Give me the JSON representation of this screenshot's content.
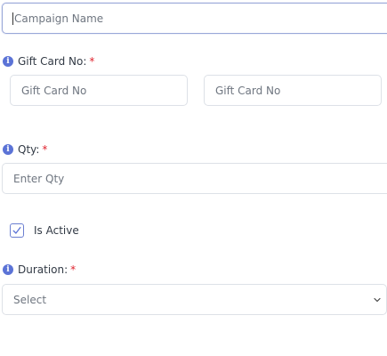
{
  "campaign_name": {
    "placeholder": "Campaign Name"
  },
  "gift_card": {
    "label": "Gift Card No:",
    "required_mark": "*",
    "from_placeholder": "Gift Card No",
    "to_placeholder": "Gift Card No"
  },
  "qty": {
    "label": "Qty:",
    "required_mark": "*",
    "placeholder": "Enter Qty"
  },
  "active": {
    "label": "Is Active",
    "checked": true
  },
  "duration": {
    "label": "Duration:",
    "required_mark": "*",
    "selected": "Select"
  },
  "colors": {
    "accent": "#5b73d6",
    "required": "#e0242f",
    "border": "#dde1e7"
  }
}
